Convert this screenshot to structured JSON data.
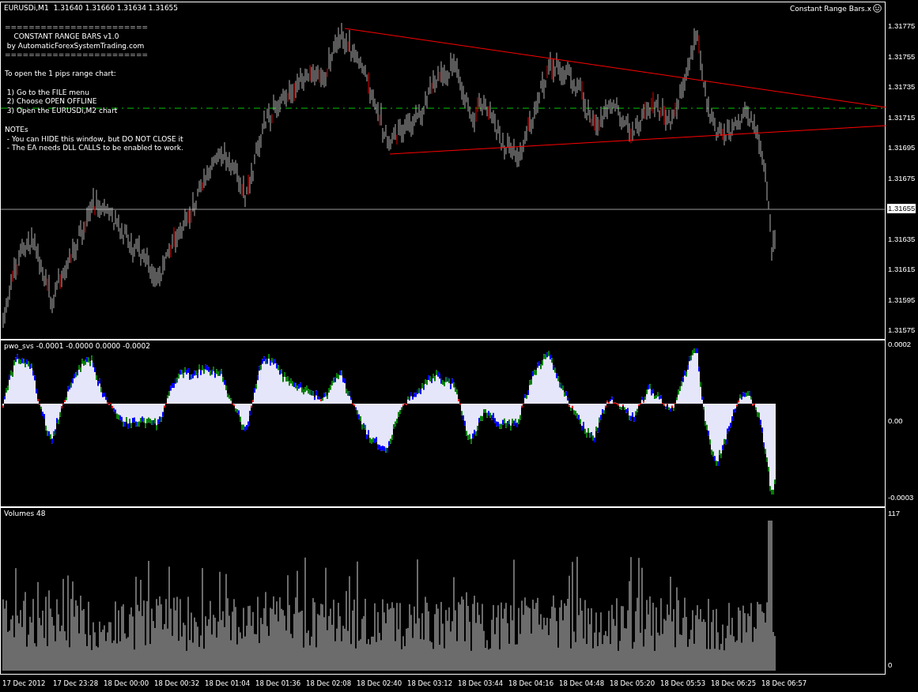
{
  "chart": {
    "title": "EURUSDi,M1",
    "ohlc": "1.31640 1.31660 1.31634 1.31655",
    "expert": "Constant Range Bars.x",
    "notes": [
      [
        "========================",
        "    CONSTANT RANGE BARS v1.0",
        " by AutomaticForexSystemTrading.com",
        "========================"
      ],
      [
        "To open the 1 pips range chart:"
      ],
      [
        " 1) Go to the FILE menu",
        " 2) Choose OPEN OFFLINE",
        " 3) Open the EURUSDi,M2 chart"
      ],
      [
        "NOTEs",
        " - You can HIDE this window, but DO NOT CLOSE it",
        " - The EA needs DLL CALLS to be enabled to work."
      ]
    ],
    "y_ticks": [
      "1.31775",
      "1.31755",
      "1.31735",
      "1.31715",
      "1.31695",
      "1.31675",
      "1.31635",
      "1.31615",
      "1.31595",
      "1.31575"
    ],
    "current_price": "1.31655"
  },
  "indicator": {
    "title": "pwo_svs -0.0001 -0.0000 0.0000 -0.0002",
    "y_ticks": [
      "0.0002",
      "0.00",
      "-0.0003"
    ]
  },
  "volumes": {
    "title": "Volumes 48",
    "y_ticks": [
      "117",
      "0"
    ]
  },
  "time_axis": [
    "17 Dec 2012",
    "17 Dec 23:28",
    "18 Dec 00:00",
    "18 Dec 00:32",
    "18 Dec 01:04",
    "18 Dec 01:36",
    "18 Dec 02:08",
    "18 Dec 02:40",
    "18 Dec 03:12",
    "18 Dec 03:44",
    "18 Dec 04:16",
    "18 Dec 04:48",
    "18 Dec 05:20",
    "18 Dec 05:53",
    "18 Dec 06:25",
    "18 Dec 06:57"
  ]
}
